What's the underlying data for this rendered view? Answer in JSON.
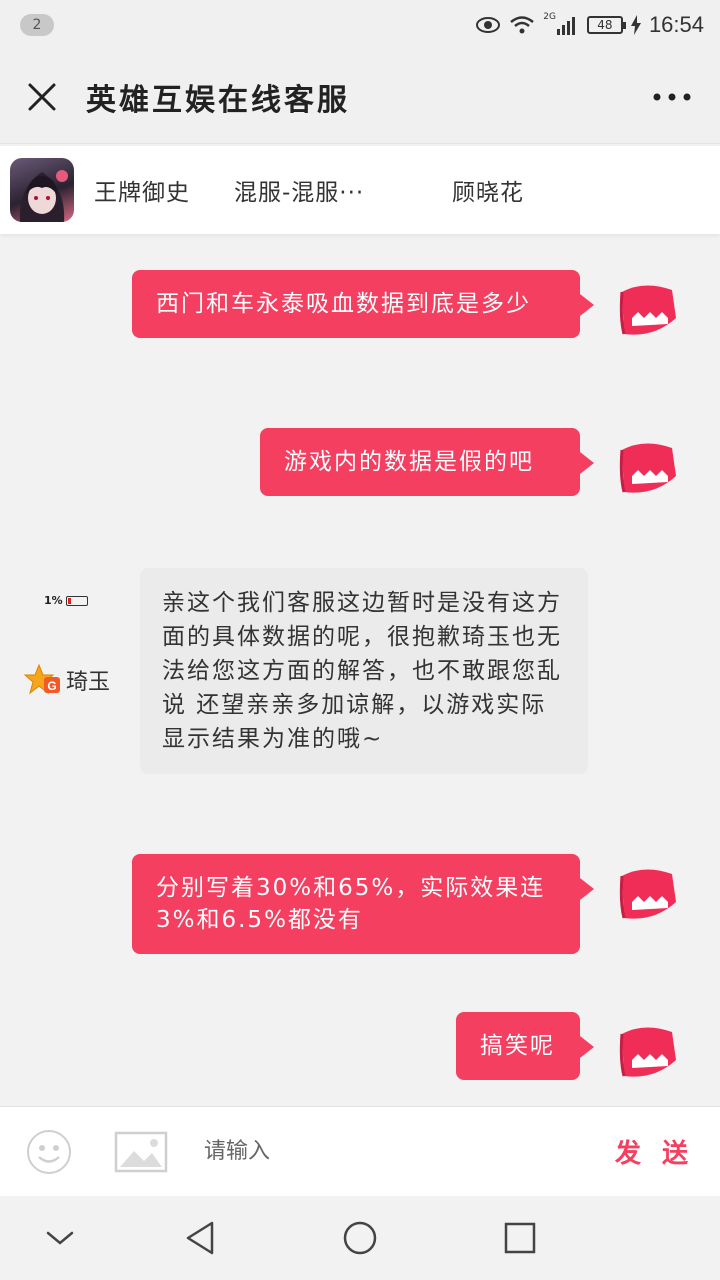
{
  "status_bar": {
    "notification_count": "2",
    "signal_label": "2G",
    "battery_level": "48",
    "time": "16:54"
  },
  "header": {
    "title": "英雄互娱在线客服"
  },
  "info_bar": {
    "game_name": "王牌御史",
    "server": "混服-混服···",
    "character": "顾晓花"
  },
  "messages": [
    {
      "from": "user",
      "text": "西门和车永泰吸血数据到底是多少"
    },
    {
      "from": "user",
      "text": "游戏内的数据是假的吧"
    },
    {
      "from": "agent",
      "text": "亲这个我们客服这边暂时是没有这方面的具体数据的呢，很抱歉琦玉也无法给您这方面的解答，也不敢跟您乱说 还望亲亲多加谅解，以游戏实际显示结果为准的哦~"
    },
    {
      "from": "user",
      "text": "分别写着30%和65%，实际效果连3%和6.5%都没有"
    },
    {
      "from": "user",
      "text": "搞笑呢"
    }
  ],
  "agent": {
    "name": "琦玉",
    "battery_text": "1%"
  },
  "input_bar": {
    "placeholder": "请输入",
    "send_label": "发 送"
  },
  "colors": {
    "accent": "#f43f60",
    "agent_bubble": "#ebebeb",
    "background": "#f2f2f2"
  },
  "icons": {
    "close": "close-icon",
    "more": "more-icon",
    "emoji": "smiley-icon",
    "image": "image-icon",
    "back": "back-triangle-icon",
    "home": "home-circle-icon",
    "recents": "recents-square-icon",
    "collapse": "chevron-down-icon"
  }
}
